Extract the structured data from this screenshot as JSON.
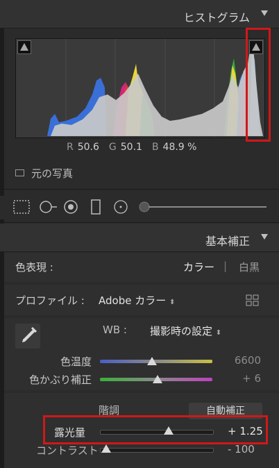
{
  "histogram": {
    "title": "ヒストグラム",
    "rgb": {
      "r_label": "R",
      "r_value": "50.6",
      "g_label": "G",
      "g_value": "50.1",
      "b_label": "B",
      "b_value": "48.9 %"
    },
    "original_photo_label": "元の写真"
  },
  "basic": {
    "title": "基本補正",
    "treatment_label": "色表現 :",
    "treatment_color": "カラー",
    "treatment_separator": "|",
    "treatment_bw": "白黒",
    "profile_label": "プロファイル :",
    "profile_value": "Adobe カラー",
    "wb_label": "WB :",
    "wb_value": "撮影時の設定",
    "temp_label": "色温度",
    "temp_value": "6600",
    "tint_label": "色かぶり補正",
    "tint_value": "+ 6",
    "tone_label": "階調",
    "auto_label": "自動補正",
    "exposure_label": "露光量",
    "exposure_value": "+ 1.25",
    "contrast_label": "コントラスト",
    "contrast_value": "- 100"
  },
  "colors": {
    "highlight_red": "#d01818",
    "panel_bg": "#2b2b2b"
  }
}
